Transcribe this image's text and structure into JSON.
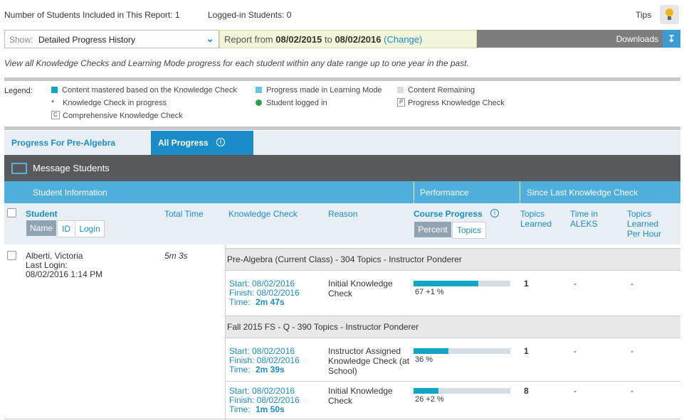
{
  "top": {
    "students_included": "Number of Students Included in This Report: 1",
    "logged_in": "Logged-in Students: 0",
    "tips": "Tips"
  },
  "filter": {
    "show_label": "Show:",
    "show_value": "Detailed Progress History",
    "report_from_label": "Report from",
    "from_date": "08/02/2015",
    "to_label": "to",
    "to_date": "08/02/2016",
    "change_label": "(Change)",
    "downloads": "Downloads"
  },
  "description": "View all Knowledge Checks and Learning Mode progress for each student within any date range up to one year in the past.",
  "legend": {
    "label": "Legend:",
    "items": {
      "mastered": "Content mastered based on the Knowledge Check",
      "progress_lm": "Progress made in Learning Mode",
      "remaining": "Content Remaining",
      "kc_in_progress": "Knowledge Check in progress",
      "logged_in": "Student logged in",
      "progress_kc": "Progress Knowledge Check",
      "comprehensive": "Comprehensive Knowledge Check"
    },
    "colors": {
      "mastered": "#11a6c5",
      "progress_lm": "#6cc3e0",
      "remaining": "#d4dde2",
      "logged_in": "#2aa14a"
    }
  },
  "tabs": {
    "tab1": "Progress For Pre-Algebra",
    "tab2": "All Progress"
  },
  "message_students": "Message Students",
  "columns": {
    "student_info": "Student Information",
    "performance": "Performance",
    "since_last": "Since Last Knowledge Check",
    "student": "Student",
    "total_time": "Total Time",
    "knowledge_check": "Knowledge Check",
    "reason": "Reason",
    "course_progress": "Course Progress",
    "topics_learned": "Topics Learned",
    "time_in_aleks": "Time in ALEKS",
    "topics_per_hour": "Topics Learned Per Hour",
    "sort_name": "Name",
    "sort_id": "ID",
    "sort_login": "Login",
    "view_percent": "Percent",
    "view_topics": "Topics"
  },
  "student": {
    "name": "Alberti, Victoria",
    "last_login_label": "Last Login:",
    "last_login": "08/02/2016 1:14 PM",
    "total_time": "5m 3s"
  },
  "classes": [
    {
      "title": "Pre-Algebra (Current Class) - 304 Topics - Instructor Ponderer",
      "rows": [
        {
          "start": "Start: 08/02/2016",
          "finish": "Finish: 08/02/2016",
          "time_label": "Time:",
          "time": "2m 47s",
          "reason": "Initial Knowledge Check",
          "progress_text": "67 +1 %",
          "progress": 0.67,
          "topics_learned": "1",
          "time_in_aleks": "-",
          "per_hour": "-"
        }
      ]
    },
    {
      "title": "Fall 2015 FS - Q - 390 Topics - Instructor Ponderer",
      "rows": [
        {
          "start": "Start: 08/02/2016",
          "finish": "Finish: 08/02/2016",
          "time_label": "Time:",
          "time": "2m 39s",
          "reason": "Instructor Assigned Knowledge Check (at School)",
          "progress_text": "36 %",
          "progress": 0.36,
          "topics_learned": "1",
          "time_in_aleks": "-",
          "per_hour": "-"
        },
        {
          "start": "Start: 08/02/2016",
          "finish": "Finish: 08/02/2016",
          "time_label": "Time:",
          "time": "1m 50s",
          "reason": "Initial Knowledge Check",
          "progress_text": "26 +2 %",
          "progress": 0.26,
          "topics_learned": "8",
          "time_in_aleks": "-",
          "per_hour": "-"
        }
      ]
    }
  ]
}
